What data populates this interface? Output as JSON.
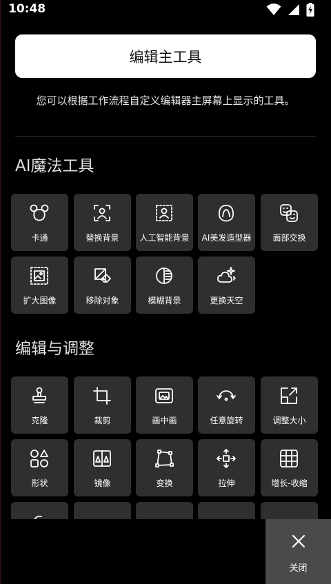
{
  "status": {
    "time": "10:48"
  },
  "header": {
    "button_label": "编辑主工具"
  },
  "description": "您可以根据工作流程自定义编辑器主屏幕上显示的工具。",
  "sections": [
    {
      "title": "AI魔法工具",
      "tools": [
        {
          "label": "卡通",
          "icon": "cartoon-icon"
        },
        {
          "label": "替换背景",
          "icon": "replace-background-icon"
        },
        {
          "label": "人工智能背景",
          "icon": "ai-background-icon"
        },
        {
          "label": "AI美发造型器",
          "icon": "ai-hair-icon"
        },
        {
          "label": "面部交换",
          "icon": "face-swap-icon"
        },
        {
          "label": "扩大图像",
          "icon": "expand-image-icon"
        },
        {
          "label": "移除对象",
          "icon": "remove-object-icon"
        },
        {
          "label": "模糊背景",
          "icon": "blur-background-icon"
        },
        {
          "label": "更换天空",
          "icon": "replace-sky-icon"
        }
      ]
    },
    {
      "title": "编辑与调整",
      "tools": [
        {
          "label": "克隆",
          "icon": "clone-stamp-icon"
        },
        {
          "label": "裁剪",
          "icon": "crop-icon"
        },
        {
          "label": "画中画",
          "icon": "picture-in-picture-icon"
        },
        {
          "label": "任意旋转",
          "icon": "free-rotate-icon"
        },
        {
          "label": "调整大小",
          "icon": "resize-icon"
        },
        {
          "label": "形状",
          "icon": "shapes-icon"
        },
        {
          "label": "镜像",
          "icon": "mirror-icon"
        },
        {
          "label": "变换",
          "icon": "transform-icon"
        },
        {
          "label": "拉伸",
          "icon": "stretch-icon"
        },
        {
          "label": "增长-收缩",
          "icon": "grow-shrink-icon"
        }
      ]
    }
  ],
  "close": {
    "label": "关闭",
    "icon": "close-icon"
  }
}
